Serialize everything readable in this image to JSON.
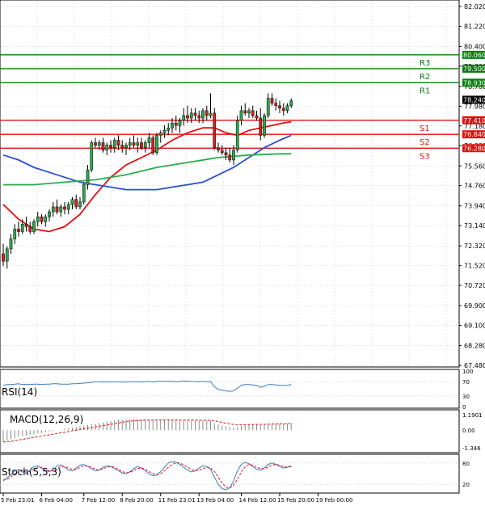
{
  "chart_data": {
    "type": "candlestick",
    "price_axis": {
      "min": 67.48,
      "max": 82.02,
      "ticks": [
        "82.020",
        "81.220",
        "80.400",
        "79.600",
        "78.780",
        "77.980",
        "77.180",
        "76.380",
        "75.560",
        "74.760",
        "73.940",
        "73.140",
        "72.320",
        "71.520",
        "70.720",
        "69.900",
        "69.100",
        "68.280",
        "67.480"
      ]
    },
    "time_labels": [
      {
        "label": "5 Feb 23:01",
        "index": 0
      },
      {
        "label": "6 Feb 04:00",
        "index": 10
      },
      {
        "label": "7 Feb 12:00",
        "index": 21
      },
      {
        "label": "8 Feb 20:00",
        "index": 31
      },
      {
        "label": "11 Feb 23:01",
        "index": 41
      },
      {
        "label": "13 Feb 04:00",
        "index": 51
      },
      {
        "label": "14 Feb 12:00",
        "index": 62
      },
      {
        "label": "15 Feb 20:00",
        "index": 72
      },
      {
        "label": "19 Feb 00:00",
        "index": 82
      }
    ],
    "levels": [
      {
        "name": "R3",
        "value": 80.06,
        "label": "80.060",
        "color": "#0a7d0a"
      },
      {
        "name": "R2",
        "value": 79.5,
        "label": "79.500",
        "color": "#0a7d0a"
      },
      {
        "name": "R1",
        "value": 78.93,
        "label": "78.930",
        "color": "#0a7d0a"
      },
      {
        "name": "S1",
        "value": 77.41,
        "label": "77.410",
        "color": "#e01010"
      },
      {
        "name": "S2",
        "value": 76.84,
        "label": "76.840",
        "color": "#e01010"
      },
      {
        "name": "S3",
        "value": 76.28,
        "label": "76.280",
        "color": "#e01010"
      }
    ],
    "current_price": {
      "value": 78.24,
      "label": "78.240"
    },
    "candles": [
      {
        "o": 72.0,
        "h": 72.4,
        "l": 71.5,
        "c": 71.7
      },
      {
        "o": 71.7,
        "h": 72.3,
        "l": 71.4,
        "c": 72.2
      },
      {
        "o": 72.2,
        "h": 72.8,
        "l": 72.0,
        "c": 72.6
      },
      {
        "o": 72.6,
        "h": 73.2,
        "l": 72.4,
        "c": 73.0
      },
      {
        "o": 73.0,
        "h": 73.3,
        "l": 72.7,
        "c": 72.9
      },
      {
        "o": 72.9,
        "h": 73.4,
        "l": 72.8,
        "c": 73.2
      },
      {
        "o": 73.2,
        "h": 73.5,
        "l": 72.9,
        "c": 73.1
      },
      {
        "o": 73.1,
        "h": 73.3,
        "l": 72.8,
        "c": 72.9
      },
      {
        "o": 72.9,
        "h": 73.4,
        "l": 72.8,
        "c": 73.3
      },
      {
        "o": 73.3,
        "h": 73.7,
        "l": 73.1,
        "c": 73.5
      },
      {
        "o": 73.5,
        "h": 73.6,
        "l": 73.2,
        "c": 73.3
      },
      {
        "o": 73.3,
        "h": 73.6,
        "l": 73.1,
        "c": 73.5
      },
      {
        "o": 73.5,
        "h": 73.8,
        "l": 73.3,
        "c": 73.7
      },
      {
        "o": 73.7,
        "h": 74.1,
        "l": 73.5,
        "c": 73.9
      },
      {
        "o": 73.9,
        "h": 74.2,
        "l": 73.6,
        "c": 73.7
      },
      {
        "o": 73.7,
        "h": 74.0,
        "l": 73.5,
        "c": 73.9
      },
      {
        "o": 73.9,
        "h": 74.1,
        "l": 73.6,
        "c": 73.8
      },
      {
        "o": 73.8,
        "h": 74.1,
        "l": 73.6,
        "c": 74.0
      },
      {
        "o": 74.0,
        "h": 74.3,
        "l": 73.8,
        "c": 74.2
      },
      {
        "o": 74.2,
        "h": 74.4,
        "l": 73.8,
        "c": 73.9
      },
      {
        "o": 73.9,
        "h": 74.3,
        "l": 73.8,
        "c": 74.1
      },
      {
        "o": 74.1,
        "h": 74.9,
        "l": 74.0,
        "c": 74.8
      },
      {
        "o": 74.8,
        "h": 75.6,
        "l": 74.6,
        "c": 75.4
      },
      {
        "o": 75.4,
        "h": 76.6,
        "l": 75.3,
        "c": 76.5
      },
      {
        "o": 76.5,
        "h": 76.7,
        "l": 76.3,
        "c": 76.4
      },
      {
        "o": 76.4,
        "h": 76.6,
        "l": 76.2,
        "c": 76.5
      },
      {
        "o": 76.5,
        "h": 76.7,
        "l": 76.1,
        "c": 76.2
      },
      {
        "o": 76.2,
        "h": 76.5,
        "l": 76.0,
        "c": 76.4
      },
      {
        "o": 76.4,
        "h": 76.6,
        "l": 76.1,
        "c": 76.3
      },
      {
        "o": 76.3,
        "h": 76.7,
        "l": 76.1,
        "c": 76.6
      },
      {
        "o": 76.6,
        "h": 76.8,
        "l": 76.2,
        "c": 76.4
      },
      {
        "o": 76.4,
        "h": 76.6,
        "l": 76.1,
        "c": 76.3
      },
      {
        "o": 76.3,
        "h": 76.5,
        "l": 76.0,
        "c": 76.4
      },
      {
        "o": 76.4,
        "h": 76.7,
        "l": 76.2,
        "c": 76.5
      },
      {
        "o": 76.5,
        "h": 76.8,
        "l": 76.3,
        "c": 76.4
      },
      {
        "o": 76.4,
        "h": 76.7,
        "l": 76.1,
        "c": 76.5
      },
      {
        "o": 76.5,
        "h": 76.7,
        "l": 76.2,
        "c": 76.3
      },
      {
        "o": 76.3,
        "h": 76.6,
        "l": 76.1,
        "c": 76.5
      },
      {
        "o": 76.5,
        "h": 76.9,
        "l": 76.3,
        "c": 76.7
      },
      {
        "o": 76.7,
        "h": 76.8,
        "l": 76.0,
        "c": 76.1
      },
      {
        "o": 76.1,
        "h": 76.9,
        "l": 76.0,
        "c": 76.8
      },
      {
        "o": 76.8,
        "h": 77.0,
        "l": 76.5,
        "c": 76.9
      },
      {
        "o": 76.9,
        "h": 77.2,
        "l": 76.7,
        "c": 77.0
      },
      {
        "o": 77.0,
        "h": 77.3,
        "l": 76.8,
        "c": 77.1
      },
      {
        "o": 77.1,
        "h": 77.5,
        "l": 76.9,
        "c": 77.3
      },
      {
        "o": 77.3,
        "h": 77.6,
        "l": 77.0,
        "c": 77.2
      },
      {
        "o": 77.2,
        "h": 77.5,
        "l": 76.9,
        "c": 77.4
      },
      {
        "o": 77.4,
        "h": 77.9,
        "l": 77.2,
        "c": 77.6
      },
      {
        "o": 77.6,
        "h": 78.0,
        "l": 77.3,
        "c": 77.5
      },
      {
        "o": 77.5,
        "h": 77.9,
        "l": 77.3,
        "c": 77.7
      },
      {
        "o": 77.7,
        "h": 77.9,
        "l": 77.4,
        "c": 77.6
      },
      {
        "o": 77.6,
        "h": 77.8,
        "l": 77.3,
        "c": 77.5
      },
      {
        "o": 77.5,
        "h": 77.9,
        "l": 77.3,
        "c": 77.8
      },
      {
        "o": 77.8,
        "h": 78.0,
        "l": 77.4,
        "c": 77.6
      },
      {
        "o": 77.6,
        "h": 78.5,
        "l": 77.5,
        "c": 77.7
      },
      {
        "o": 77.7,
        "h": 77.9,
        "l": 76.2,
        "c": 76.3
      },
      {
        "o": 76.3,
        "h": 76.5,
        "l": 76.1,
        "c": 76.2
      },
      {
        "o": 76.2,
        "h": 76.4,
        "l": 76.0,
        "c": 76.1
      },
      {
        "o": 76.1,
        "h": 76.3,
        "l": 75.8,
        "c": 76.0
      },
      {
        "o": 76.0,
        "h": 76.3,
        "l": 75.7,
        "c": 75.8
      },
      {
        "o": 75.8,
        "h": 76.4,
        "l": 75.6,
        "c": 76.2
      },
      {
        "o": 76.2,
        "h": 77.6,
        "l": 76.1,
        "c": 77.4
      },
      {
        "o": 77.4,
        "h": 78.0,
        "l": 77.2,
        "c": 77.8
      },
      {
        "o": 77.8,
        "h": 78.1,
        "l": 77.6,
        "c": 77.7
      },
      {
        "o": 77.7,
        "h": 77.9,
        "l": 77.5,
        "c": 77.8
      },
      {
        "o": 77.8,
        "h": 78.0,
        "l": 77.5,
        "c": 77.6
      },
      {
        "o": 77.6,
        "h": 77.8,
        "l": 77.4,
        "c": 77.5
      },
      {
        "o": 77.5,
        "h": 77.9,
        "l": 76.6,
        "c": 76.8
      },
      {
        "o": 76.8,
        "h": 77.7,
        "l": 76.7,
        "c": 77.6
      },
      {
        "o": 77.6,
        "h": 78.5,
        "l": 77.5,
        "c": 78.3
      },
      {
        "o": 78.3,
        "h": 78.5,
        "l": 78.0,
        "c": 78.1
      },
      {
        "o": 78.1,
        "h": 78.3,
        "l": 77.8,
        "c": 78.0
      },
      {
        "o": 78.0,
        "h": 78.2,
        "l": 77.7,
        "c": 77.9
      },
      {
        "o": 77.9,
        "h": 78.1,
        "l": 77.6,
        "c": 77.8
      },
      {
        "o": 77.8,
        "h": 78.1,
        "l": 77.7,
        "c": 78.0
      },
      {
        "o": 78.0,
        "h": 78.3,
        "l": 77.9,
        "c": 78.2
      }
    ],
    "moving_averages": [
      {
        "color": "#e01010",
        "points": [
          [
            0,
            74.0
          ],
          [
            4,
            73.4
          ],
          [
            8,
            73.0
          ],
          [
            12,
            72.9
          ],
          [
            16,
            73.1
          ],
          [
            20,
            73.6
          ],
          [
            24,
            74.4
          ],
          [
            28,
            75.1
          ],
          [
            32,
            75.6
          ],
          [
            36,
            75.9
          ],
          [
            40,
            76.2
          ],
          [
            44,
            76.6
          ],
          [
            48,
            76.9
          ],
          [
            52,
            77.1
          ],
          [
            55,
            77.1
          ],
          [
            58,
            76.9
          ],
          [
            61,
            76.8
          ],
          [
            64,
            77.0
          ],
          [
            67,
            77.1
          ],
          [
            70,
            77.2
          ],
          [
            73,
            77.3
          ],
          [
            75,
            77.35
          ]
        ]
      },
      {
        "color": "#2a4fd0",
        "points": [
          [
            0,
            76.0
          ],
          [
            4,
            75.8
          ],
          [
            8,
            75.5
          ],
          [
            12,
            75.3
          ],
          [
            16,
            75.1
          ],
          [
            20,
            74.9
          ],
          [
            24,
            74.8
          ],
          [
            28,
            74.7
          ],
          [
            32,
            74.6
          ],
          [
            36,
            74.6
          ],
          [
            40,
            74.6
          ],
          [
            44,
            74.7
          ],
          [
            48,
            74.8
          ],
          [
            52,
            74.9
          ],
          [
            56,
            75.2
          ],
          [
            60,
            75.5
          ],
          [
            64,
            75.9
          ],
          [
            68,
            76.3
          ],
          [
            72,
            76.6
          ],
          [
            75,
            76.8
          ]
        ]
      },
      {
        "color": "#2eaa4a",
        "points": [
          [
            0,
            74.8
          ],
          [
            8,
            74.8
          ],
          [
            16,
            74.9
          ],
          [
            24,
            75.0
          ],
          [
            32,
            75.2
          ],
          [
            40,
            75.5
          ],
          [
            48,
            75.7
          ],
          [
            56,
            75.9
          ],
          [
            64,
            76.0
          ],
          [
            72,
            76.05
          ],
          [
            75,
            76.05
          ]
        ]
      }
    ],
    "rsi": {
      "label": "RSI(14)",
      "ticks": [
        "100",
        "70",
        "30",
        "0"
      ],
      "color": "#3c78c8",
      "values": [
        60,
        62,
        62,
        63,
        64,
        62,
        63,
        62,
        63,
        63,
        62,
        63,
        63,
        64,
        64,
        63,
        63,
        63,
        64,
        64,
        65,
        66,
        67,
        68,
        70,
        70,
        69,
        70,
        69,
        70,
        70,
        69,
        69,
        70,
        70,
        70,
        69,
        70,
        71,
        69,
        71,
        71,
        71,
        71,
        71,
        70,
        71,
        72,
        71,
        71,
        70,
        70,
        71,
        70,
        70,
        56,
        48,
        46,
        44,
        43,
        44,
        52,
        60,
        62,
        62,
        61,
        60,
        54,
        57,
        62,
        62,
        61,
        60,
        59,
        60,
        62
      ]
    },
    "macd": {
      "label": "MACD(12,26,9)",
      "ticks": [
        "1.1901",
        "0.00",
        "-1.346"
      ],
      "signal_color": "#e01010",
      "bar_color": "#8a8a8a",
      "histogram": [
        -0.85,
        -0.8,
        -0.7,
        -0.6,
        -0.5,
        -0.45,
        -0.4,
        -0.35,
        -0.3,
        -0.25,
        -0.2,
        -0.15,
        -0.1,
        -0.05,
        0.0,
        0.05,
        0.1,
        0.15,
        0.2,
        0.25,
        0.3,
        0.35,
        0.4,
        0.45,
        0.5,
        0.55,
        0.6,
        0.65,
        0.7,
        0.75,
        0.8,
        0.82,
        0.84,
        0.85,
        0.85,
        0.85,
        0.84,
        0.84,
        0.83,
        0.82,
        0.82,
        0.81,
        0.8,
        0.8,
        0.79,
        0.79,
        0.78,
        0.78,
        0.77,
        0.77,
        0.76,
        0.76,
        0.75,
        0.75,
        0.74,
        0.55,
        0.45,
        0.35,
        0.3,
        0.25,
        0.2,
        0.25,
        0.35,
        0.4,
        0.45,
        0.45,
        0.45,
        0.4,
        0.42,
        0.5,
        0.52,
        0.52,
        0.5,
        0.5,
        0.52,
        0.55
      ],
      "signal": [
        -0.9,
        -0.88,
        -0.85,
        -0.8,
        -0.75,
        -0.7,
        -0.65,
        -0.6,
        -0.55,
        -0.5,
        -0.45,
        -0.4,
        -0.35,
        -0.3,
        -0.25,
        -0.2,
        -0.15,
        -0.1,
        -0.05,
        0.0,
        0.05,
        0.1,
        0.15,
        0.2,
        0.25,
        0.3,
        0.35,
        0.4,
        0.45,
        0.5,
        0.55,
        0.6,
        0.65,
        0.7,
        0.72,
        0.74,
        0.76,
        0.77,
        0.78,
        0.78,
        0.79,
        0.79,
        0.79,
        0.79,
        0.79,
        0.79,
        0.78,
        0.78,
        0.78,
        0.78,
        0.77,
        0.77,
        0.76,
        0.76,
        0.76,
        0.72,
        0.66,
        0.6,
        0.54,
        0.48,
        0.44,
        0.42,
        0.42,
        0.42,
        0.43,
        0.44,
        0.45,
        0.45,
        0.45,
        0.46,
        0.47,
        0.48,
        0.49,
        0.5,
        0.5,
        0.51
      ]
    },
    "stoch": {
      "label": "Stoch(5,5,3)",
      "ticks": [
        "80",
        "20"
      ],
      "main_color": "#3c78c8",
      "signal_color": "#e01010",
      "main": [
        30,
        38,
        48,
        58,
        62,
        55,
        50,
        60,
        70,
        72,
        65,
        60,
        55,
        62,
        72,
        75,
        68,
        60,
        58,
        66,
        74,
        76,
        70,
        64,
        58,
        60,
        68,
        72,
        70,
        64,
        58,
        52,
        50,
        56,
        64,
        70,
        66,
        58,
        50,
        44,
        46,
        56,
        68,
        80,
        84,
        82,
        76,
        68,
        60,
        55,
        58,
        66,
        72,
        70,
        62,
        40,
        20,
        8,
        5,
        10,
        30,
        58,
        76,
        82,
        78,
        70,
        62,
        60,
        66,
        76,
        80,
        76,
        70,
        66,
        68,
        72
      ],
      "signal": [
        32,
        34,
        40,
        50,
        56,
        58,
        54,
        56,
        62,
        68,
        68,
        64,
        58,
        58,
        64,
        70,
        70,
        66,
        62,
        62,
        68,
        72,
        72,
        68,
        62,
        60,
        64,
        68,
        70,
        68,
        62,
        56,
        52,
        54,
        58,
        64,
        66,
        62,
        56,
        50,
        48,
        50,
        58,
        68,
        76,
        80,
        80,
        74,
        68,
        62,
        58,
        60,
        64,
        68,
        66,
        56,
        40,
        24,
        12,
        10,
        18,
        34,
        54,
        70,
        76,
        74,
        68,
        64,
        64,
        68,
        74,
        76,
        74,
        70,
        68,
        70
      ]
    }
  }
}
